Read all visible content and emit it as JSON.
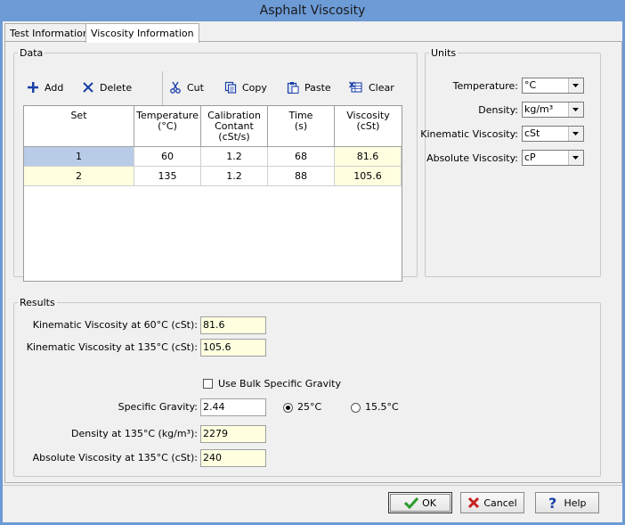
{
  "window": {
    "title": "Asphalt Viscosity"
  },
  "tabs": [
    {
      "label": "Test Information"
    },
    {
      "label": "Viscosity Information"
    }
  ],
  "data": {
    "legend": "Data",
    "toolbar": {
      "add": "Add",
      "delete": "Delete",
      "cut": "Cut",
      "copy": "Copy",
      "paste": "Paste",
      "clear": "Clear"
    },
    "columns": [
      {
        "line1": "Set",
        "line2": "",
        "line3": ""
      },
      {
        "line1": "Temperature",
        "line2": "(°C)",
        "line3": ""
      },
      {
        "line1": "Calibration",
        "line2": "Contant",
        "line3": "(cSt/s)"
      },
      {
        "line1": "Time",
        "line2": "(s)",
        "line3": ""
      },
      {
        "line1": "Viscosity",
        "line2": "(cSt)",
        "line3": ""
      }
    ],
    "rows": [
      {
        "set": "1",
        "temperature": "60",
        "calibration": "1.2",
        "time": "68",
        "viscosity": "81.6"
      },
      {
        "set": "2",
        "temperature": "135",
        "calibration": "1.2",
        "time": "88",
        "viscosity": "105.6"
      }
    ]
  },
  "units": {
    "legend": "Units",
    "temperature_label": "Temperature:",
    "temperature_value": "°C",
    "density_label": "Density:",
    "density_value": "kg/m³",
    "kinematic_label": "Kinematic Viscosity:",
    "kinematic_value": "cSt",
    "absolute_label": "Absolute Viscosity:",
    "absolute_value": "cP"
  },
  "results": {
    "legend": "Results",
    "kv60_label": "Kinematic Viscosity at 60°C (cSt):",
    "kv60_value": "81.6",
    "kv135_label": "Kinematic Viscosity at 135°C (cSt):",
    "kv135_value": "105.6",
    "bulk_label": "Use Bulk Specific Gravity",
    "sg_label": "Specific Gravity:",
    "sg_value": "2.44",
    "radio_25": "25°C",
    "radio_155": "15.5°C",
    "density_label": "Density at 135°C (kg/m³):",
    "density_value": "2279",
    "absvisc_label": "Absolute Viscosity at 135°C (cSt):",
    "absvisc_value": "240"
  },
  "buttons": {
    "ok": "OK",
    "cancel": "Cancel",
    "help": "Help"
  }
}
